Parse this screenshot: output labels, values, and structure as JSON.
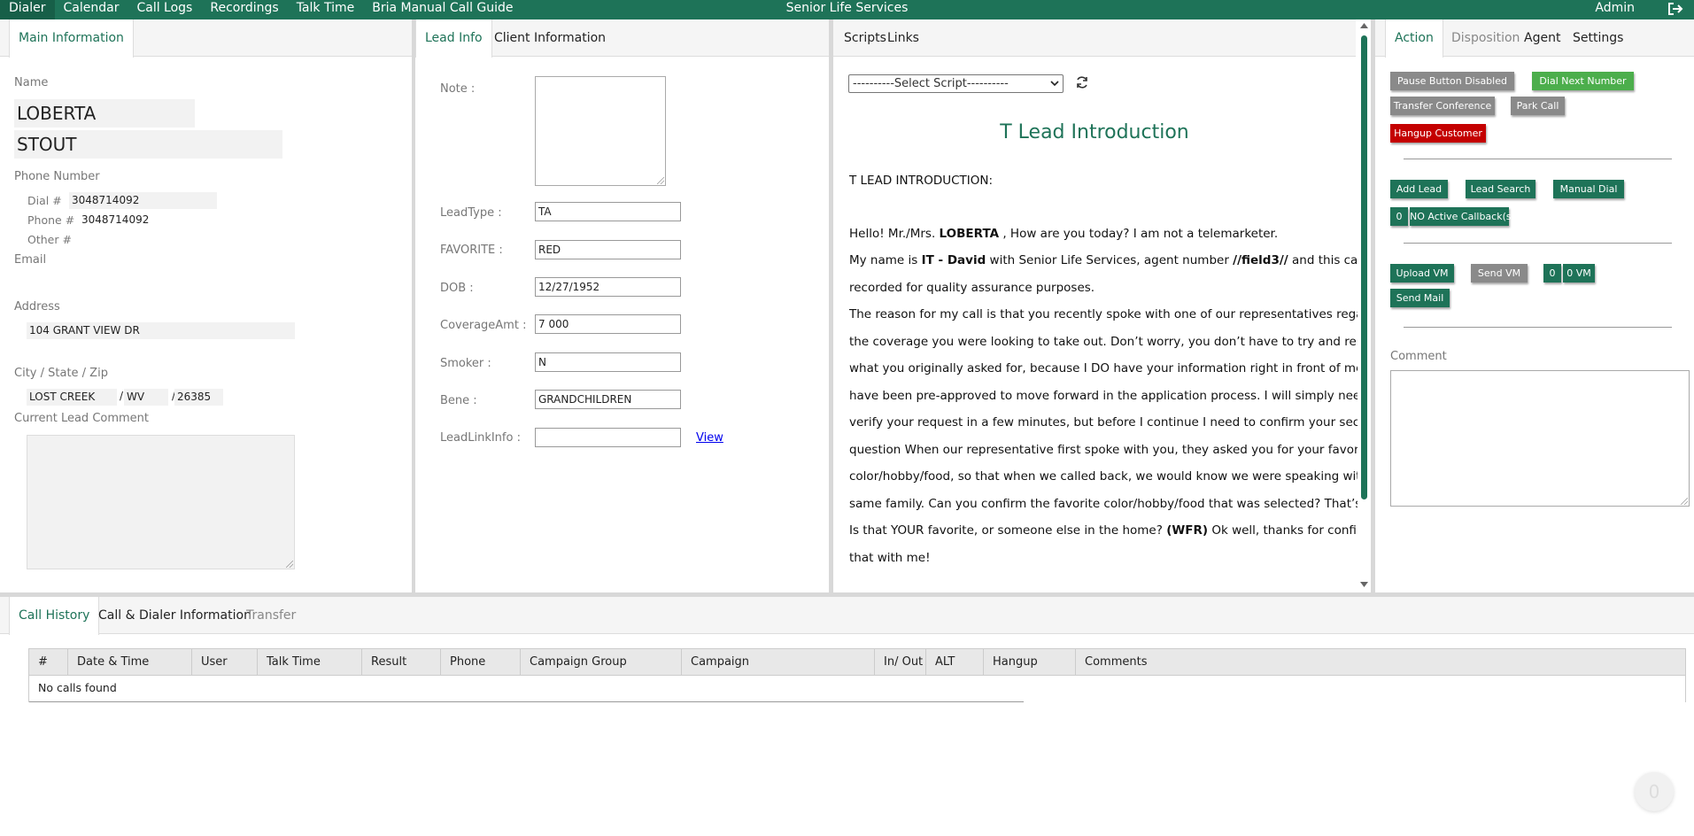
{
  "topbar": {
    "nav": [
      "Dialer",
      "Calendar",
      "Call Logs",
      "Recordings",
      "Talk Time",
      "Bria Manual Call Guide"
    ],
    "brand": "Senior Life Services",
    "user": "Admin"
  },
  "main_info": {
    "tab": "Main Information",
    "name_label": "Name",
    "first_name": "LOBERTA",
    "middle_initial": "",
    "last_name": "STOUT",
    "phone_label": "Phone Number",
    "dial_label": "Dial #",
    "dial_value": "3048714092",
    "phone_label2": "Phone #",
    "phone_value": "3048714092",
    "other_label": "Other #",
    "other_value": "",
    "email_label": "Email",
    "email_value": "",
    "address_label": "Address",
    "address1": "104 GRANT VIEW DR",
    "address2": "",
    "csz_label": "City / State / Zip",
    "city": "LOST CREEK",
    "state": "WV",
    "zip": "26385",
    "slash": "/",
    "comment_label": "Current Lead Comment"
  },
  "lead_info": {
    "tabs": [
      "Lead Info",
      "Client Information"
    ],
    "note_label": "Note :",
    "fields": [
      {
        "label": "LeadType :",
        "value": "TA"
      },
      {
        "label": "FAVORITE :",
        "value": "RED"
      },
      {
        "label": "DOB :",
        "value": "12/27/1952"
      },
      {
        "label": "CoverageAmt :",
        "value": "7 000"
      },
      {
        "label": "Smoker :",
        "value": "N"
      },
      {
        "label": "Bene :",
        "value": "GRANDCHILDREN"
      },
      {
        "label": "LeadLinkInfo :",
        "value": ""
      }
    ],
    "view_link": "View"
  },
  "scripts": {
    "tabs": [
      "Scripts",
      "Links"
    ],
    "select_value": "----------Select Script----------",
    "title": "T Lead Introduction",
    "heading": "T LEAD INTRODUCTION:",
    "lines": [
      {
        "a": "Hello! Mr./Mrs. ",
        "b": "LOBERTA",
        "c": " , How are you today? I am not a telemarketer."
      },
      {
        "a": "My name is ",
        "b": "IT - David",
        "c": " with Senior Life Services, agent number ",
        "d": "//field3//",
        "e": "  and this call may be"
      },
      {
        "a": "recorded for quality assurance purposes."
      },
      {
        "a": "The reason for my call is that you recently spoke with one of our representatives regarding"
      },
      {
        "a": "the coverage you were looking to take out. Don’t worry, you don’t have to try and remember"
      },
      {
        "a": "what you originally asked for, because I DO have your information right in front of me. You"
      },
      {
        "a": "have been pre-approved to move forward in the application process. I will simply need to"
      },
      {
        "a": "verify your request in a few minutes, but before I continue I need to confirm your security"
      },
      {
        "a": "question When our representative first spoke with you, they asked you for your favorite"
      },
      {
        "a": "color/hobby/food, so that when we called back, we would know we were speaking with the"
      },
      {
        "a": "same family. Can you confirm the favorite color/hobby/food that was selected? That’s correct!"
      },
      {
        "a": "Is that YOUR favorite, or someone else in the home?  ",
        "b": "(WFR)",
        "c": " Ok well, thanks for confirming"
      },
      {
        "a": "that with me!"
      }
    ]
  },
  "action": {
    "tabs": [
      "Action",
      "Disposition",
      "Agent",
      "Settings"
    ],
    "pause": "Pause Button Disabled",
    "dial_next": "Dial Next Number",
    "transfer": "Transfer Conference",
    "park": "Park Call",
    "hangup": "Hangup Customer",
    "add_lead": "Add Lead",
    "lead_search": "Lead Search",
    "manual_dial": "Manual Dial",
    "callback_count": "0",
    "callback_label": "NO Active Callback(s)",
    "upload_vm": "Upload VM",
    "send_vm": "Send VM",
    "vm_count": "0",
    "vm_label": "0 VM",
    "send_mail": "Send Mail",
    "comment_label": "Comment"
  },
  "bottom": {
    "tabs": [
      "Call History",
      "Call & Dialer Information",
      "Transfer"
    ],
    "columns": [
      "#",
      "Date & Time",
      "User",
      "Talk Time",
      "Result",
      "Phone",
      "Campaign Group",
      "Campaign",
      "In/ Out",
      "ALT",
      "Hangup",
      "Comments"
    ],
    "empty_text": "No calls found"
  },
  "badge": "0",
  "colors": {
    "brand": "#1e7358",
    "red": "#c40000",
    "light_green": "#4cae4c",
    "gray": "#8a8a8a"
  }
}
